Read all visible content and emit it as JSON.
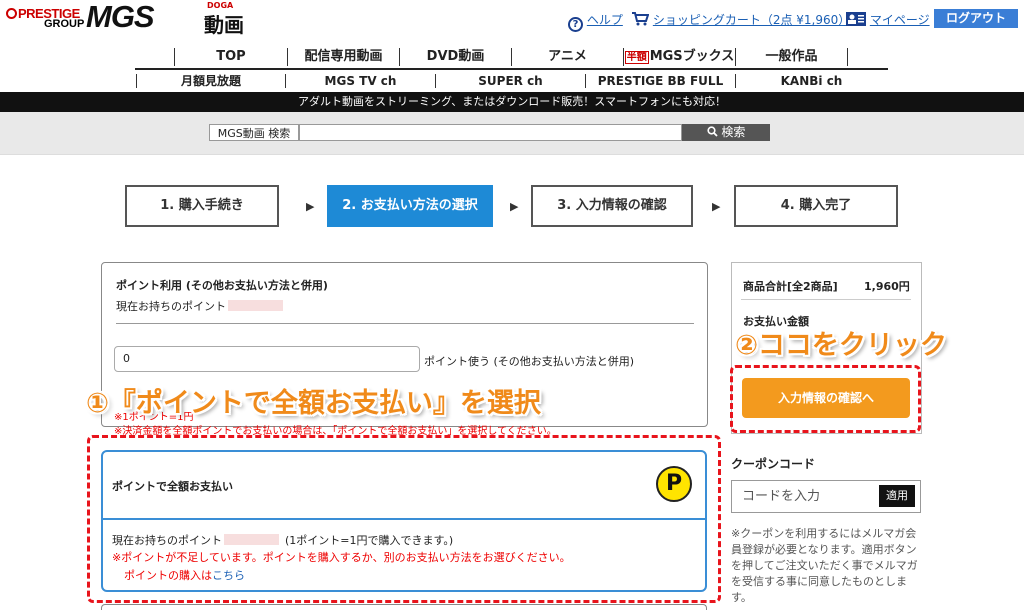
{
  "header": {
    "logo_prestige": "PRESTIGE",
    "logo_group": "GROUP",
    "logo_mgs": "MGS",
    "logo_doga": "DOGA",
    "logo_jp": "動画",
    "help": "ヘルプ",
    "cart": "ショッピングカート（2点 ¥1,960）",
    "mypage": "マイページ",
    "logout": "ログアウト"
  },
  "nav": {
    "main": [
      "TOP",
      "配信専用動画",
      "DVD動画",
      "アニメ",
      "MGSブックス",
      "一般作品"
    ],
    "books_tag": "半額",
    "sub": [
      "月額見放題",
      "MGS TV ch",
      "SUPER ch",
      "PRESTIGE BB FULL",
      "KANBi ch"
    ]
  },
  "banner": "アダルト動画をストリーミング、またはダウンロード販売！スマートフォンにも対応！",
  "search": {
    "label": "MGS動画 検索",
    "button": "検索"
  },
  "steps": [
    "1. 購入手続き",
    "2. お支払い方法の選択",
    "3. 入力情報の確認",
    "4. 購入完了"
  ],
  "active_step": 2,
  "point_panel": {
    "title": "ポイント利用 (その他お支払い方法と併用)",
    "current_points": "現在お持ちのポイント",
    "input_value": "0",
    "input_suffix": "ポイント使う (その他お支払い方法と併用)",
    "note_partial_1": "※1ポイント=1円",
    "note_partial_2": "※決済金額を全額ポイントでお支払いの場合は、「ポイントで全額お支払い」を選択してください。"
  },
  "full_point_panel": {
    "title": "ポイントで全額お支払い",
    "badge": "P",
    "current_points": "現在お持ちのポイント",
    "rate": "(1ポイント=1円で購入できます。)",
    "warning": "※ポイントが不足しています。ポイントを購入するか、別のお支払い方法をお選びください。",
    "buy_prefix": "ポイントの購入は",
    "buy_link": "こちら"
  },
  "summary": {
    "label": "商品合計[全2商品]",
    "value": "1,960円",
    "payment_label": "お支払い金額",
    "confirm_button": "入力情報の確認へ"
  },
  "coupon": {
    "title": "クーポンコード",
    "placeholder": "コードを入力",
    "apply": "適用",
    "note": "※クーポンを利用するにはメルマガ会員登録が必要となります。適用ボタンを押してご注文いただく事でメルマガを受信する事に同意したものとします。"
  },
  "annotations": {
    "step1": "①『ポイントで全額お支払い』を選択",
    "step2": "②ココをクリック"
  },
  "colors": {
    "accent_blue": "#1e8ad6",
    "orange": "#f39a1e",
    "annotation_red": "#e8141c",
    "annotation_text": "#f08a1a"
  }
}
